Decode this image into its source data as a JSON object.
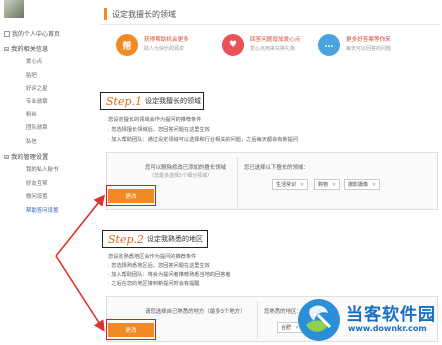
{
  "sidebar": {
    "home_link": "我的个人中心首页",
    "group1": "我的相关信息",
    "group1_items": [
      "爱心点",
      "贴吧",
      "好评之星",
      "专业勋章",
      "粉丝",
      "团队勋章",
      "私信"
    ],
    "group2": "我的管理设置",
    "group2_items": [
      "我的私人秘书",
      "好友互帮",
      "微问设置",
      "帮助答问设置"
    ]
  },
  "main": {
    "title": "设定我擅长的领域",
    "features": [
      {
        "icon": "帮",
        "title": "获得帮助机会更多",
        "desc": "助人为快乐的源泉",
        "color": "#f08a24"
      },
      {
        "icon": "♥",
        "title": "回答问题增加爱心点",
        "desc": "爱心点用来兑换礼物",
        "color": "#e8525b"
      },
      {
        "icon": "…",
        "title": "更多好答案等你来",
        "desc": "每天可以回答的问题",
        "color": "#4aa3df"
      }
    ]
  },
  "step1": {
    "num": "Step.1",
    "label": "设定我擅长的领域",
    "desc": [
      "您设定擅长的领域会作为提问的推荐条件",
      "· 您选择擅长领域后，您回答问题在这里生效",
      "· 加入帮助团队：通过设定领域可以选择和行业相关的问题，之后每天都会有新提问"
    ],
    "panel_text": "您可以删除修改已添加的擅长领域",
    "panel_sub": "（您最多选择5个细分领域）",
    "right_label": "您已选择以下擅长的领域：",
    "tags": [
      "生活常识",
      "购物",
      "摄影摄像"
    ],
    "change_label": "更改"
  },
  "step2": {
    "num": "Step.2",
    "label": "设定我熟悉的地区",
    "desc": [
      "您设定熟悉地区会作为提问的推荐条件",
      "· 您选择熟悉地区后，您回答问题在这里生效",
      "· 加入帮助团队：将会为提问者推荐熟悉当地的回答者",
      "· 之后在您的地区接到新提问时会有提醒"
    ],
    "panel_text": "请您选择自己熟悉的地方（最多3个地方）",
    "right_label": "您熟悉的地区：",
    "tags": [
      "合肥"
    ],
    "change_label": "更改"
  },
  "watermark": {
    "title": "当客软件园",
    "url": "www.downkr.com"
  },
  "colors": {
    "accent": "#f08a24",
    "highlight": "#d41e1e",
    "arrow": "#e0312a"
  }
}
